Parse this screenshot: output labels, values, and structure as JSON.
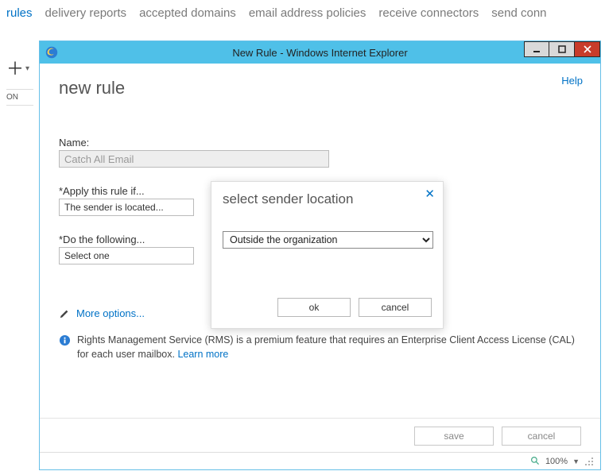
{
  "nav": {
    "tabs": [
      "rules",
      "delivery reports",
      "accepted domains",
      "email address policies",
      "receive connectors",
      "send conn"
    ],
    "active_index": 0
  },
  "left_tools": {
    "on_label": "ON"
  },
  "window": {
    "title": "New Rule - Windows Internet Explorer"
  },
  "page": {
    "help": "Help",
    "title": "new rule",
    "name_label": "Name:",
    "name_value": "Catch All Email",
    "apply_label": "*Apply this rule if...",
    "apply_value": "The sender is located...",
    "do_label": "*Do the following...",
    "do_value": "Select one",
    "more_options": "More options...",
    "info_text": "Rights Management Service (RMS) is a premium feature that requires an Enterprise Client Access License (CAL) for each user mailbox. ",
    "learn_more": "Learn more",
    "save": "save",
    "cancel": "cancel"
  },
  "modal": {
    "title": "select sender location",
    "selected": "Outside the organization",
    "ok": "ok",
    "cancel": "cancel"
  },
  "status": {
    "zoom": "100%"
  }
}
